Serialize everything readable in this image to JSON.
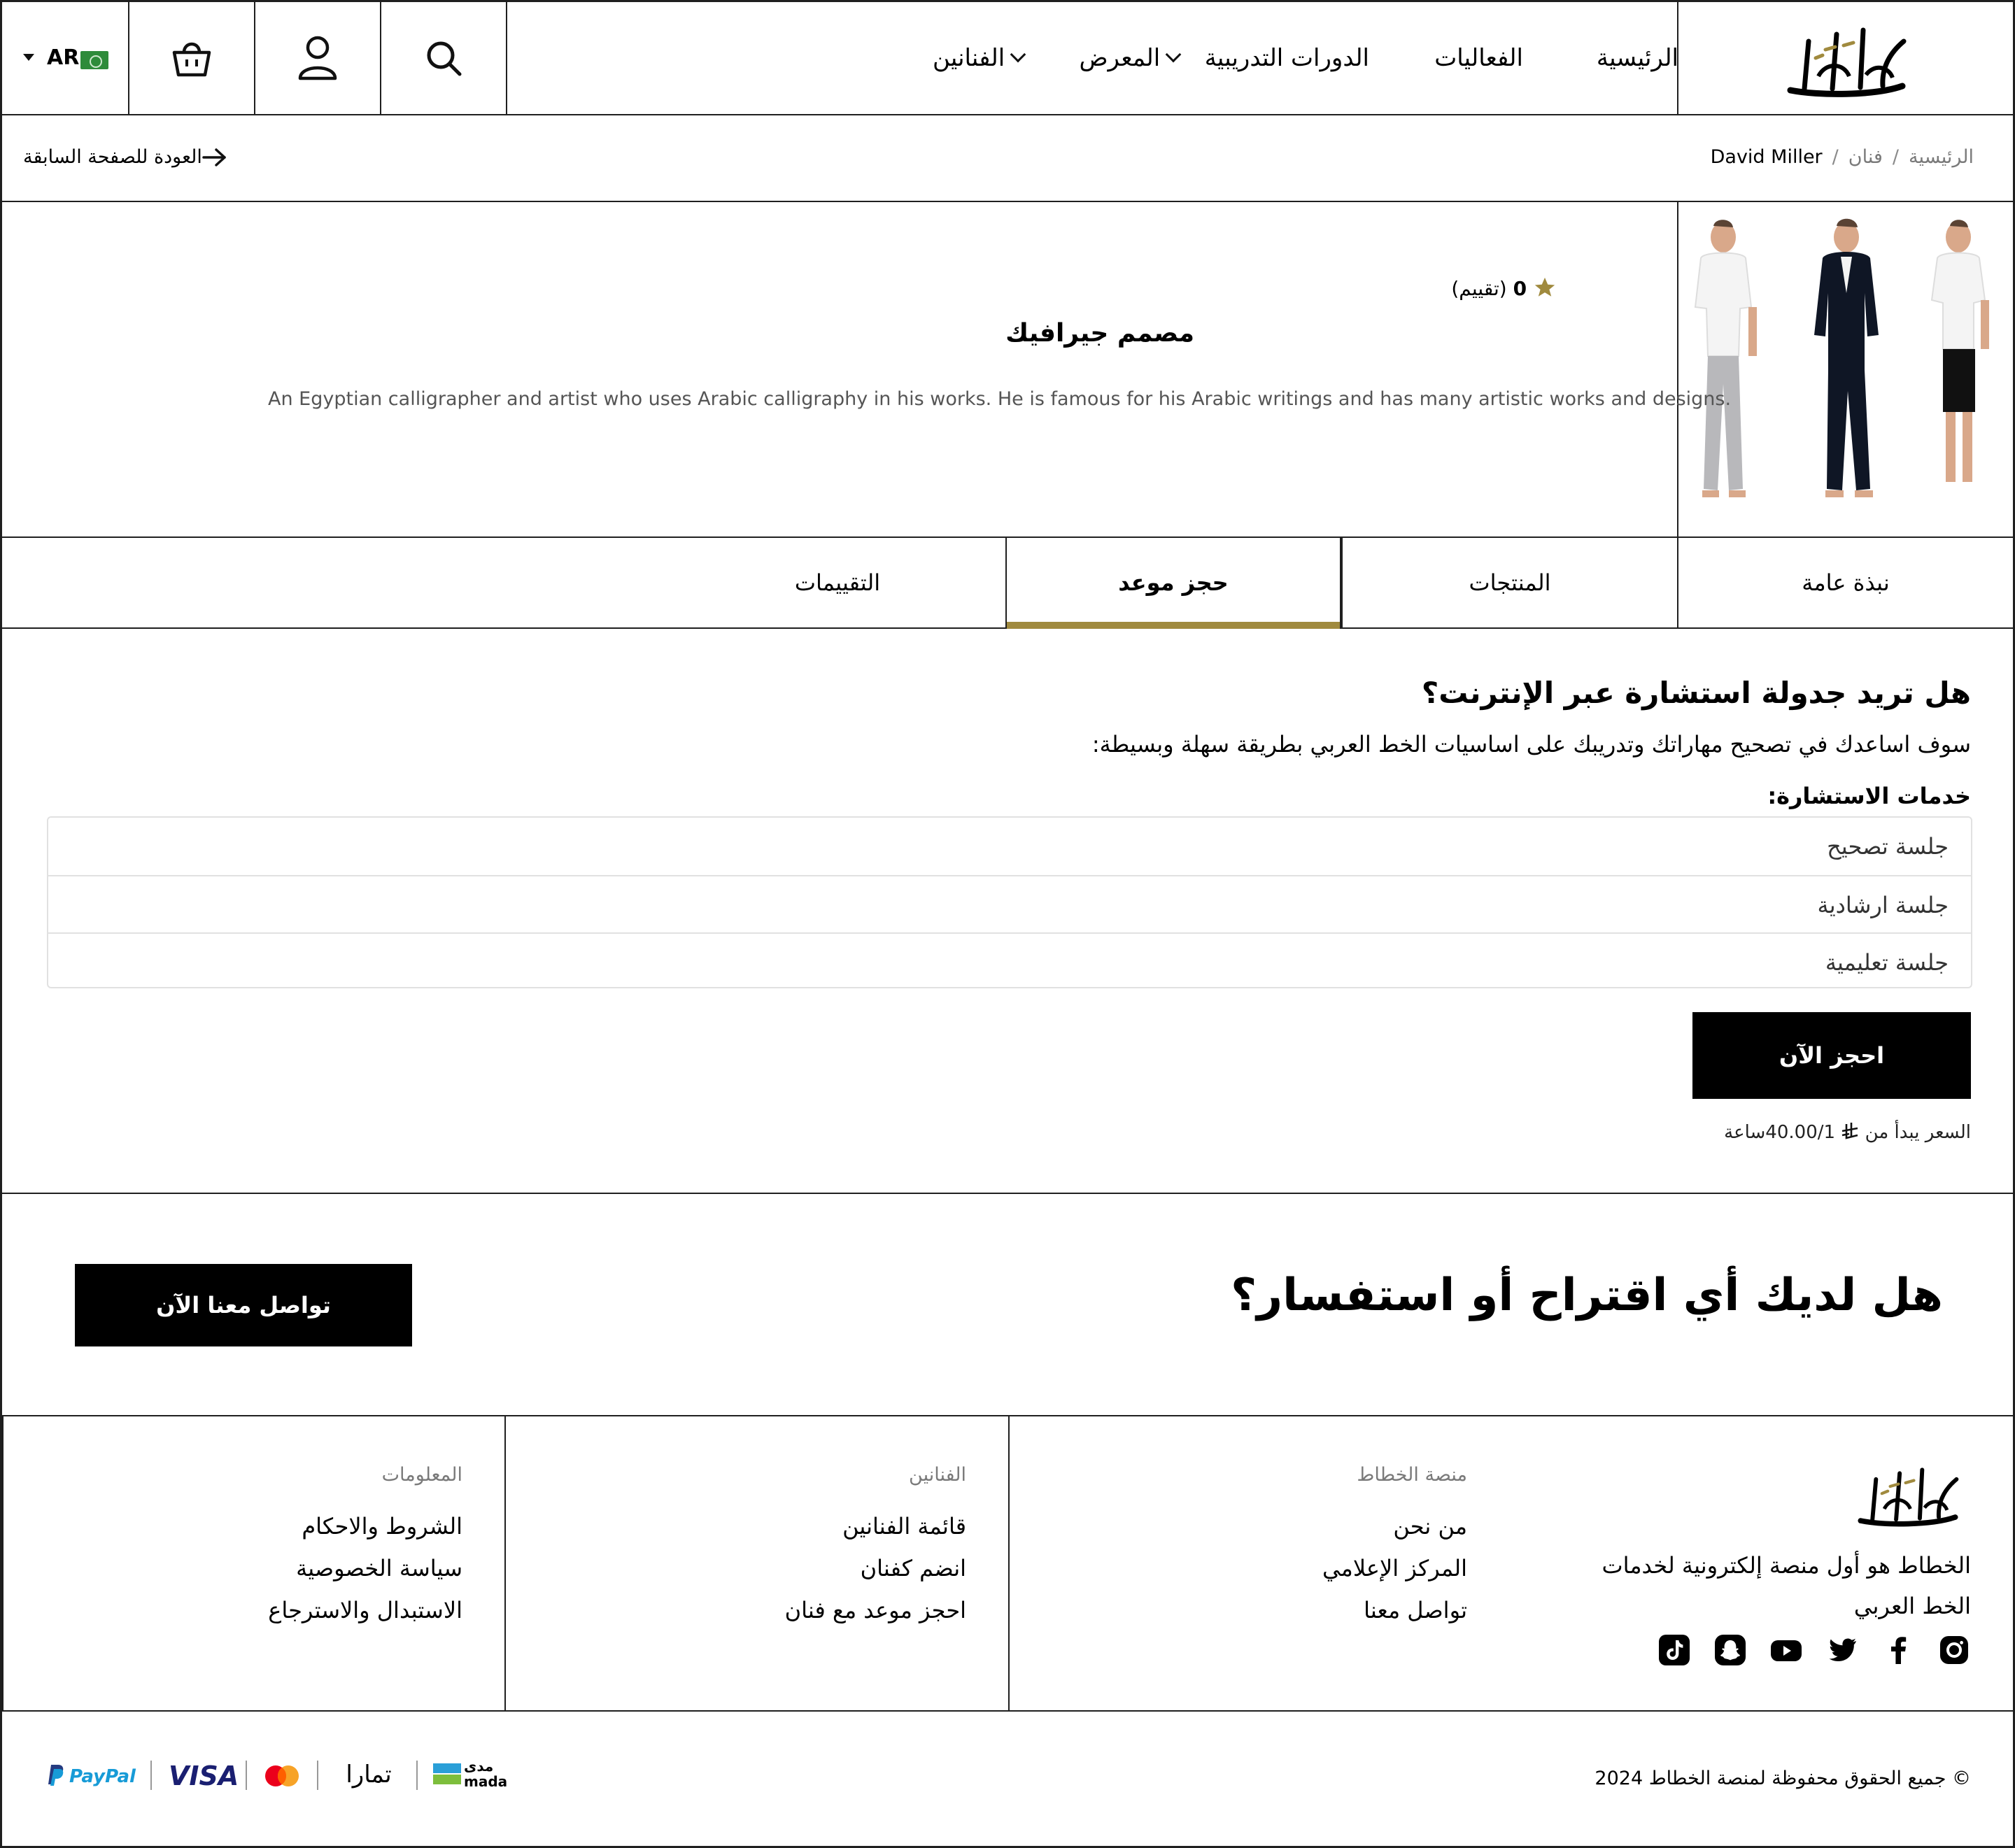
{
  "header": {
    "nav": [
      {
        "label": "الرئيسية"
      },
      {
        "label": "الفعاليات"
      },
      {
        "label": "الدورات التدريبية"
      },
      {
        "label": "المعرض"
      },
      {
        "label": "الفنانين"
      }
    ],
    "language": "AR"
  },
  "breadcrumb": {
    "home": "الرئيسية",
    "section": "فنان",
    "current": "David Miller",
    "back_label": "العودة للصفحة السابقة"
  },
  "artist": {
    "rating_count": "0",
    "rating_label": "(تقييم)",
    "title": "مصمم جيرافيك",
    "description": "An Egyptian calligrapher and artist who uses Arabic calligraphy in his works. He is famous for his Arabic writings and has many artistic works and designs."
  },
  "tabs": [
    {
      "label": "نبذة عامة"
    },
    {
      "label": "المنتجات"
    },
    {
      "label": "حجز موعد"
    },
    {
      "label": "التقييمات"
    }
  ],
  "booking": {
    "title": "هل تريد جدولة استشارة عبر الإنترنت؟",
    "subtitle": "سوف اساعدك في تصحيح مهاراتك وتدريبك على اساسيات الخط العربي بطريقة سهلة وبسيطة:",
    "services_label": "خدمات الاستشارة:",
    "services": [
      "جلسة تصحيح",
      "جلسة ارشادية",
      "جلسة تعليمية"
    ],
    "button": "احجز الآن",
    "price_prefix": "السعر يبدأ من",
    "price_value": "40.00/1ساعة"
  },
  "cta": {
    "title": "هل لديك أي اقتراح أو استفسار؟",
    "button": "تواصل معنا الآن"
  },
  "footer": {
    "about": "الخطاط هو أول منصة إلكترونية لخدمات الخط العربي",
    "columns": [
      {
        "title": "منصة الخطاط",
        "links": [
          "من نحن",
          "المركز الإعلامي",
          "تواصل معنا"
        ]
      },
      {
        "title": "الفنانين",
        "links": [
          "قائمة الفنانين",
          "انضم كفنان",
          "احجز موعد مع فنان"
        ]
      },
      {
        "title": "المعلومات",
        "links": [
          "الشروط والاحكام",
          "سياسة الخصوصية",
          "الاستبدال والاسترجاع"
        ]
      }
    ],
    "socials": [
      "instagram-icon",
      "facebook-icon",
      "twitter-icon",
      "youtube-icon",
      "snapchat-icon",
      "tiktok-icon"
    ],
    "copyright": "© جميع الحقوق محفوظة لمنصة الخطاط 2024"
  },
  "payments": {
    "mada_ar": "مدى",
    "mada_en": "mada",
    "tamara": "تمارا",
    "visa": "VISA",
    "paypal": "PayPal"
  },
  "colors": {
    "accent_gold": "#a08a3e",
    "black": "#000000"
  }
}
